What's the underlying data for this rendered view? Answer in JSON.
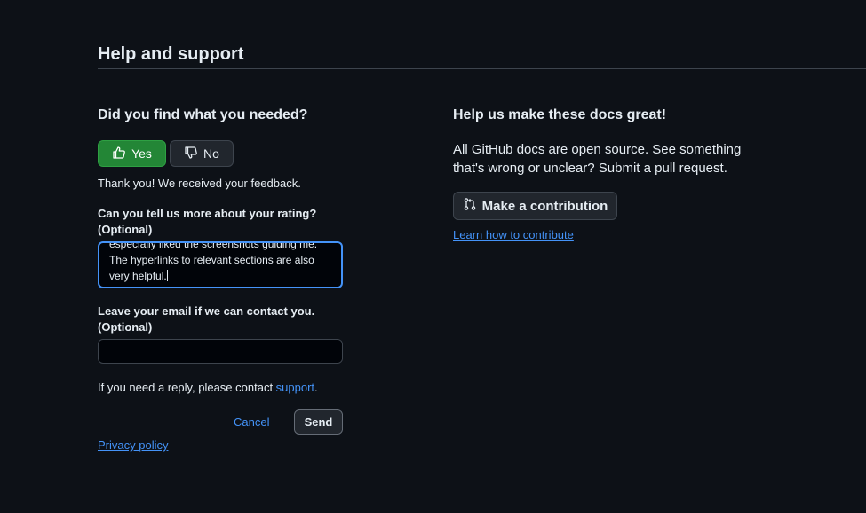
{
  "section": {
    "title": "Help and support"
  },
  "feedback": {
    "question": "Did you find what you needed?",
    "yes_label": "Yes",
    "no_label": "No",
    "thanks": "Thank you! We received your feedback.",
    "rating_label": "Can you tell us more about your rating? (Optional)",
    "rating_lines": [
      "especially liked the screenshots guiding me.",
      "The hyperlinks to relevant sections are also",
      "very helpful."
    ],
    "email_label": "Leave your email if we can contact you. (Optional)",
    "email_value": "",
    "reply_prefix": "If you need a reply, please contact ",
    "reply_link": "support",
    "reply_suffix": ".",
    "cancel_label": "Cancel",
    "send_label": "Send",
    "privacy_label": "Privacy policy"
  },
  "contribute": {
    "heading": "Help us make these docs great!",
    "description": "All GitHub docs are open source. See something that's wrong or unclear? Submit a pull request.",
    "button_label": "Make a contribution",
    "learn_link": "Learn how to contribute"
  },
  "icons": {
    "yes": "thumbs-up-icon",
    "no": "thumbs-down-icon",
    "contribute": "git-pull-request-icon"
  },
  "colors": {
    "background": "#0d1117",
    "accent": "#4493f8",
    "success": "#238636"
  }
}
